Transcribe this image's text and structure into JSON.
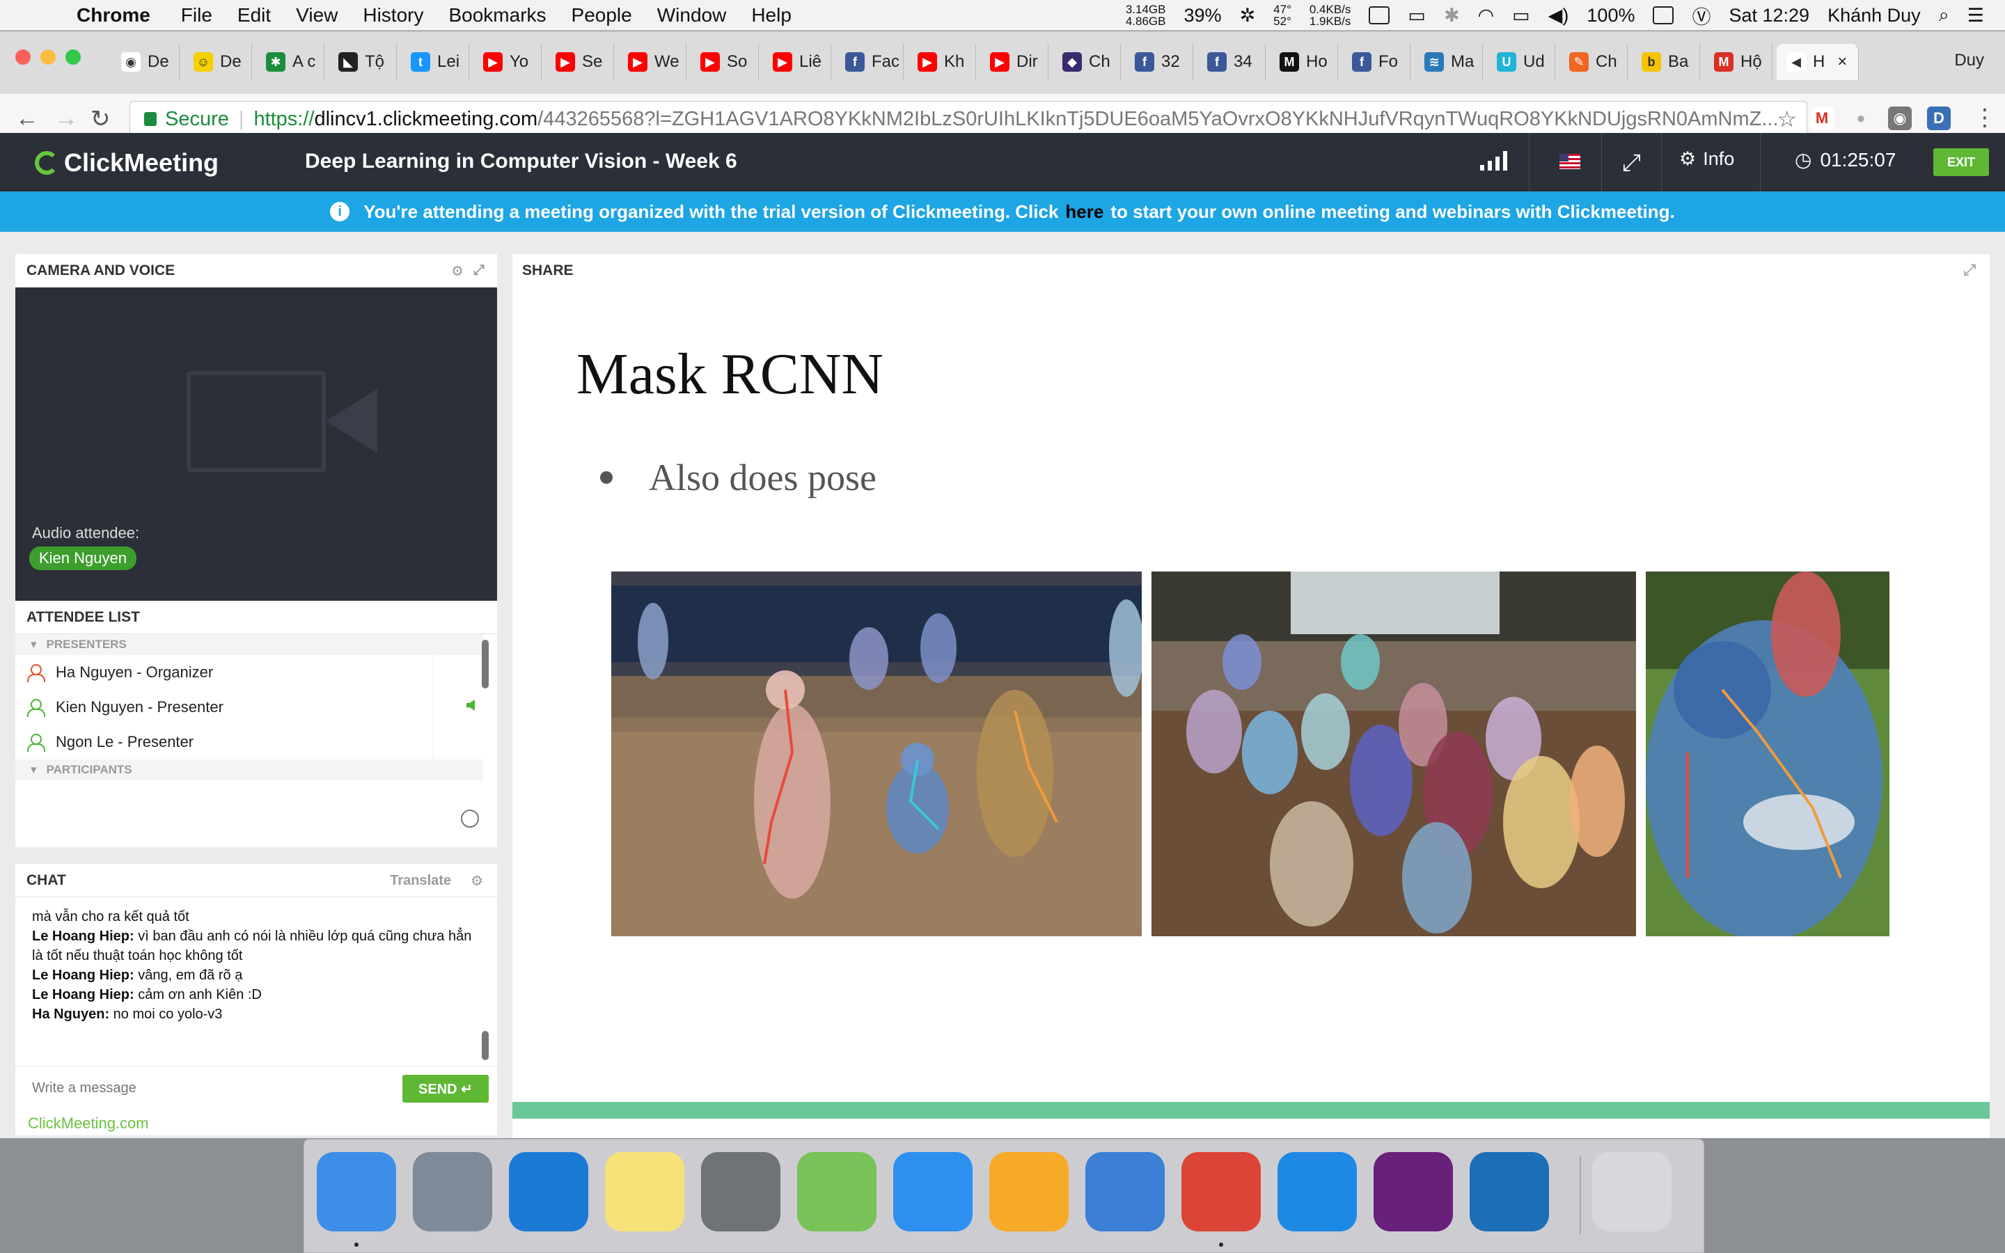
{
  "menubar": {
    "app": "Chrome",
    "items": [
      "File",
      "Edit",
      "View",
      "History",
      "Bookmarks",
      "People",
      "Window",
      "Help"
    ],
    "mem_top": "3.14GB",
    "mem_bottom": "4.86GB",
    "cpu": "39%",
    "temp_top": "47°",
    "temp_bottom": "52°",
    "net_up": "0.4KB/s",
    "net_down": "1.9KB/s",
    "battery": "100%",
    "clock": "Sat 12:29",
    "user": "Khánh Duy"
  },
  "browser": {
    "tabs": [
      {
        "label": "De",
        "color": "#ffffff",
        "glyph": "◉"
      },
      {
        "label": "De",
        "color": "#f5d100",
        "glyph": "☺"
      },
      {
        "label": "A c",
        "color": "#1c8d3d",
        "glyph": "✱"
      },
      {
        "label": "Tộ",
        "color": "#222222",
        "glyph": "◣"
      },
      {
        "label": "Lei",
        "color": "#1a94ff",
        "glyph": "t"
      },
      {
        "label": "Yo",
        "color": "#ff0000",
        "glyph": "▶"
      },
      {
        "label": "Se",
        "color": "#ff0000",
        "glyph": "▶"
      },
      {
        "label": "We",
        "color": "#ff0000",
        "glyph": "▶"
      },
      {
        "label": "So",
        "color": "#ff0000",
        "glyph": "▶"
      },
      {
        "label": "Liê",
        "color": "#ff0000",
        "glyph": "▶"
      },
      {
        "label": "Fac",
        "color": "#3b5998",
        "glyph": "f"
      },
      {
        "label": "Kh",
        "color": "#ff0000",
        "glyph": "▶"
      },
      {
        "label": "Dir",
        "color": "#ff0000",
        "glyph": "▶"
      },
      {
        "label": "Ch",
        "color": "#3a2a6e",
        "glyph": "◆"
      },
      {
        "label": "32",
        "color": "#3b5998",
        "glyph": "f"
      },
      {
        "label": "34",
        "color": "#3b5998",
        "glyph": "f"
      },
      {
        "label": "Ho",
        "color": "#111111",
        "glyph": "M"
      },
      {
        "label": "Fo",
        "color": "#3b5998",
        "glyph": "f"
      },
      {
        "label": "Ma",
        "color": "#2a7ab8",
        "glyph": "≋"
      },
      {
        "label": "Ud",
        "color": "#1fb4d8",
        "glyph": "U"
      },
      {
        "label": "Ch",
        "color": "#f26522",
        "glyph": "✎"
      },
      {
        "label": "Ba",
        "color": "#f5c400",
        "glyph": "b"
      },
      {
        "label": "Hộ",
        "color": "#d93025",
        "glyph": "M"
      },
      {
        "label": "H",
        "color": "#ffffff",
        "glyph": "◀"
      }
    ],
    "profile": "Duy",
    "secure_label": "Secure",
    "url_proto": "https://",
    "url_host": "dlincv1.clickmeeting.com",
    "url_rest": "/443265568?l=ZGH1AGV1ARO8YKkNM2IbLzS0rUIhLKIknTj5DUE6oaM5YaOvrxO8YKkNHJufVRqynTWuqRO8YKkNDUjgsRN0AmNmZ..."
  },
  "meeting": {
    "logo": "ClickMeeting",
    "title": "Deep Learning in Computer Vision - Week 6",
    "info_label": "Info",
    "timer": "01:25:07",
    "exit_label": "EXIT",
    "banner_before": "You're attending a meeting organized with the trial version of Clickmeeting. Click",
    "banner_link": "here",
    "banner_after": "to start your own online meeting and webinars with Clickmeeting."
  },
  "camera_panel": {
    "title": "CAMERA AND VOICE",
    "audio_label": "Audio attendee:",
    "audio_name": "Kien Nguyen"
  },
  "attendee_panel": {
    "title": "ATTENDEE LIST",
    "presenters_label": "PRESENTERS",
    "participants_label": "PARTICIPANTS",
    "presenters": [
      {
        "name": "Ha Nguyen - Organizer",
        "color": "#e0532c"
      },
      {
        "name": "Kien Nguyen  - Presenter",
        "color": "#4cb535"
      },
      {
        "name": "Ngon Le  - Presenter",
        "color": "#4cb535"
      }
    ]
  },
  "chat_panel": {
    "title": "CHAT",
    "translate_label": "Translate",
    "messages": [
      {
        "author": "",
        "text": "mà vẫn cho ra kết quả tốt"
      },
      {
        "author": "Le Hoang Hiep:",
        "text": " vì ban đầu anh có nói là nhiều lớp quá cũng chưa hẳn là tốt nếu thuật toán học không tốt"
      },
      {
        "author": "Le Hoang Hiep:",
        "text": " vâng, em đã rõ ạ"
      },
      {
        "author": "Le Hoang Hiep:",
        "text": " cảm ơn anh Kiên :D"
      },
      {
        "author": "Ha Nguyen:",
        "text": " no moi co yolo-v3"
      }
    ],
    "input_placeholder": "Write a message",
    "send_label": "SEND",
    "powered_by": "ClickMeeting.com"
  },
  "share_panel": {
    "title": "SHARE",
    "slide_title": "Mask RCNN",
    "slide_bullet": "Also does pose",
    "slide_progress": 1.0
  },
  "colors": {
    "accent_green": "#5fb834",
    "banner_blue": "#1ea5e3",
    "header_dark": "#2b2f38"
  },
  "dock": {
    "apps": [
      {
        "name": "finder-icon",
        "color": "#3d8ee8"
      },
      {
        "name": "launchpad-icon",
        "color": "#7e8a98"
      },
      {
        "name": "itunes-icon",
        "color": "#1b7ad6"
      },
      {
        "name": "notes-icon",
        "color": "#f7e27a"
      },
      {
        "name": "system-preferences-icon",
        "color": "#6f7378"
      },
      {
        "name": "android-studio-icon",
        "color": "#78c257"
      },
      {
        "name": "app-store-icon",
        "color": "#2d8ff0"
      },
      {
        "name": "sketch-icon",
        "color": "#f7a928"
      },
      {
        "name": "vmware-icon",
        "color": "#3b7fd6"
      },
      {
        "name": "chrome-icon",
        "color": "#db4437"
      },
      {
        "name": "keyhole-icon",
        "color": "#1e88e5"
      },
      {
        "name": "visual-studio-icon",
        "color": "#68217a"
      },
      {
        "name": "vscode-icon",
        "color": "#1c6fb6"
      },
      {
        "name": "trash-icon",
        "color": "#d8d8dc"
      }
    ]
  }
}
